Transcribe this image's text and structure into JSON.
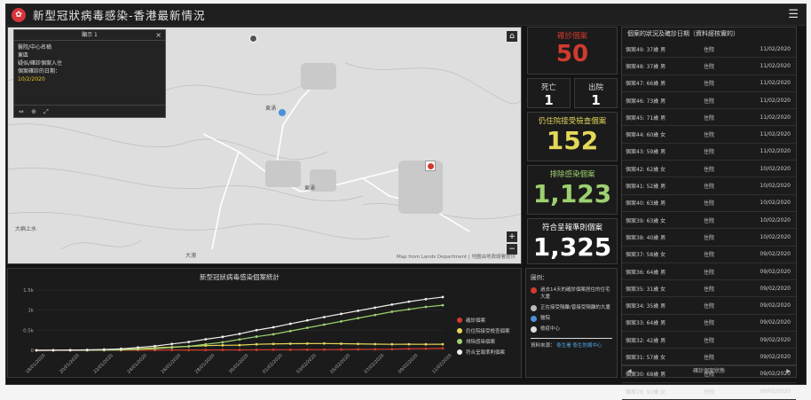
{
  "header": {
    "title": "新型冠狀病毒感染-香港最新情況",
    "menu_icon": "menu-icon"
  },
  "map": {
    "labels": [
      "東涌",
      "東涌",
      "大嶼上水",
      "大澳"
    ],
    "popup": {
      "title": "顯示 1",
      "close": "×",
      "lines": [
        "醫院/中心名稱",
        "東區",
        "疑似/確診個案入住",
        "個案確診的日期："
      ],
      "date": "10/2/2020",
      "tools": "⇔ ⊕ ⤢"
    },
    "attribution": "Map from Lands Department | 地圖由地政總署提供"
  },
  "stats": {
    "confirmed": {
      "label": "確診個案",
      "value": "50",
      "color": "#d23a2e"
    },
    "deaths": {
      "label": "死亡",
      "value": "1"
    },
    "discharged": {
      "label": "出院",
      "value": "1"
    },
    "hospital": {
      "label": "仍住院接受檢查個案",
      "value": "152",
      "color": "#e4d85a"
    },
    "excluded": {
      "label": "排除感染個案",
      "value": "1,123",
      "color": "#9ed070"
    },
    "reported": {
      "label": "符合呈報準則個案",
      "value": "1,325",
      "color": "#ffffff"
    }
  },
  "list": {
    "header": "個案的狀況及確診日期（資料經核實的）",
    "rows": [
      {
        "case": "個案49: 37歲 男",
        "status": "住院",
        "date": "11/02/2020"
      },
      {
        "case": "個案48: 37歲 男",
        "status": "住院",
        "date": "11/02/2020"
      },
      {
        "case": "個案47: 66歲 男",
        "status": "住院",
        "date": "11/02/2020"
      },
      {
        "case": "個案46: 73歲 男",
        "status": "住院",
        "date": "11/02/2020"
      },
      {
        "case": "個案45: 71歲 男",
        "status": "住院",
        "date": "11/02/2020"
      },
      {
        "case": "個案44: 60歲 女",
        "status": "住院",
        "date": "11/02/2020"
      },
      {
        "case": "個案43: 59歲 男",
        "status": "住院",
        "date": "11/02/2020"
      },
      {
        "case": "個案42: 62歲 女",
        "status": "住院",
        "date": "10/02/2020"
      },
      {
        "case": "個案41: 52歲 男",
        "status": "住院",
        "date": "10/02/2020"
      },
      {
        "case": "個案40: 63歲 男",
        "status": "住院",
        "date": "10/02/2020"
      },
      {
        "case": "個案39: 63歲 女",
        "status": "住院",
        "date": "10/02/2020"
      },
      {
        "case": "個案38: 40歲 男",
        "status": "住院",
        "date": "10/02/2020"
      },
      {
        "case": "個案37: 58歲 女",
        "status": "住院",
        "date": "09/02/2020"
      },
      {
        "case": "個案36: 64歲 男",
        "status": "住院",
        "date": "09/02/2020"
      },
      {
        "case": "個案35: 31歲 女",
        "status": "住院",
        "date": "09/02/2020"
      },
      {
        "case": "個案34: 35歲 男",
        "status": "住院",
        "date": "09/02/2020"
      },
      {
        "case": "個案33: 64歲 男",
        "status": "住院",
        "date": "09/02/2020"
      },
      {
        "case": "個案32: 42歲 男",
        "status": "住院",
        "date": "09/02/2020"
      },
      {
        "case": "個案31: 57歲 女",
        "status": "住院",
        "date": "09/02/2020"
      },
      {
        "case": "個案30: 68歲 男",
        "status": "住院",
        "date": "09/02/2020"
      },
      {
        "case": "個案29: 91歲 女",
        "status": "住院",
        "date": "09/02/2020"
      }
    ],
    "footer": "確診個案狀態",
    "prev": "◀",
    "next": "▶"
  },
  "legend": {
    "title": "圖例：",
    "items": [
      {
        "text": "過去14天的確診個案居住的住宅大廈",
        "color": "#d23a2e"
      },
      {
        "text": "正在接受隔離/曾接受隔離的大廈",
        "color": "#bbbbbb"
      },
      {
        "text": "醫院",
        "color": "#4a90d9"
      },
      {
        "text": "檢疫中心",
        "color": "#dddddd"
      }
    ],
    "source_label": "資料來源：",
    "source_text": "衞生署 衞生防護中心"
  },
  "chart_data": {
    "type": "line",
    "title": "新型冠狀病毒感染個案統計",
    "x": [
      "18/01/2020",
      "19/01/2020",
      "20/01/2020",
      "21/01/2020",
      "22/01/2020",
      "23/01/2020",
      "24/01/2020",
      "25/01/2020",
      "26/01/2020",
      "27/01/2020",
      "28/01/2020",
      "29/01/2020",
      "30/01/2020",
      "31/01/2020",
      "01/02/2020",
      "02/02/2020",
      "03/02/2020",
      "04/02/2020",
      "05/02/2020",
      "06/02/2020",
      "07/02/2020",
      "08/02/2020",
      "09/02/2020",
      "10/02/2020",
      "11/02/2020"
    ],
    "ylim": [
      0,
      1500
    ],
    "yticks": [
      "0",
      "0.5k",
      "1k",
      "1.5k"
    ],
    "series": [
      {
        "name": "確診個案",
        "color": "#d23a2e",
        "values": [
          0,
          0,
          0,
          0,
          1,
          2,
          5,
          5,
          8,
          8,
          8,
          10,
          10,
          12,
          14,
          15,
          17,
          18,
          21,
          24,
          26,
          29,
          38,
          42,
          50
        ]
      },
      {
        "name": "仍住院接受檢查個案",
        "color": "#e4d85a",
        "values": [
          0,
          2,
          4,
          8,
          15,
          25,
          40,
          60,
          80,
          100,
          118,
          125,
          130,
          150,
          160,
          165,
          168,
          170,
          165,
          160,
          155,
          150,
          152,
          150,
          152
        ]
      },
      {
        "name": "排除感染個案",
        "color": "#9ed070",
        "values": [
          0,
          1,
          2,
          3,
          5,
          10,
          25,
          40,
          70,
          100,
          150,
          200,
          270,
          340,
          400,
          480,
          560,
          640,
          720,
          800,
          880,
          960,
          1020,
          1080,
          1123
        ]
      },
      {
        "name": "符合呈報準則個案",
        "color": "#eeeeee",
        "values": [
          0,
          3,
          6,
          11,
          21,
          37,
          70,
          105,
          158,
          208,
          276,
          335,
          410,
          502,
          574,
          660,
          745,
          828,
          906,
          984,
          1061,
          1139,
          1210,
          1272,
          1325
        ]
      }
    ]
  }
}
